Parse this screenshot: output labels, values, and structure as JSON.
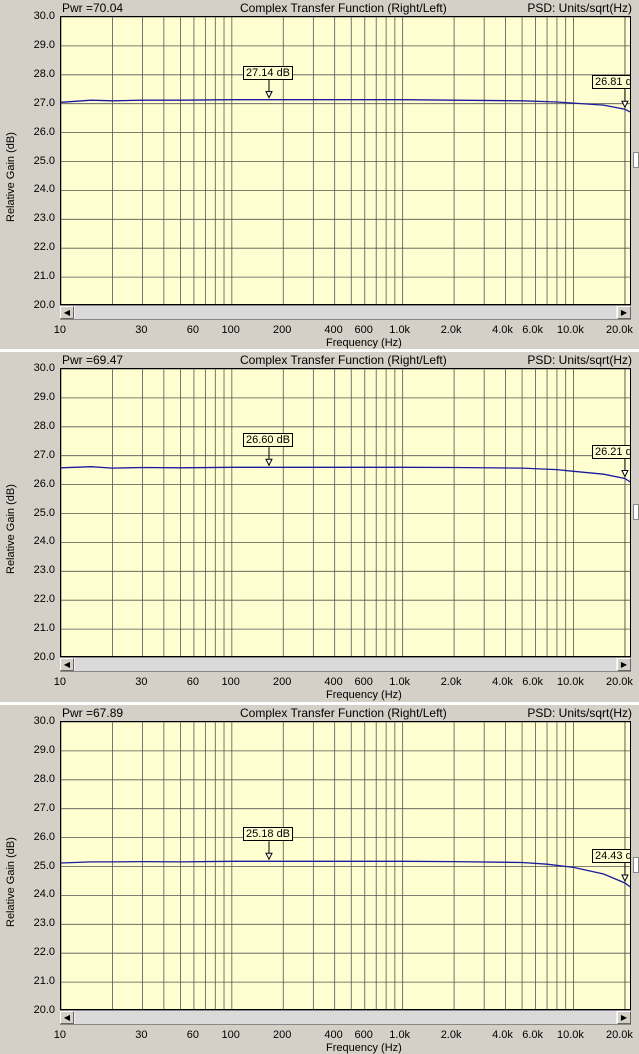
{
  "colors": {
    "plot_bg": "#fefed0",
    "grid": "#000000",
    "trace": "#1a1aa0",
    "window_bg": "#d4d0c8"
  },
  "icons": [
    "scroll-left-arrow-icon",
    "scroll-right-arrow-icon"
  ],
  "chart_data": [
    {
      "type": "line",
      "pwr_label": "Pwr =70.04",
      "title": "Complex Transfer Function (Right/Left)",
      "psd_label": "PSD: Units/sqrt(Hz)",
      "xlabel": "Frequency (Hz)",
      "ylabel": "Relative Gain (dB)",
      "xscale": "log",
      "xlim": [
        10,
        22000
      ],
      "ylim": [
        20.0,
        30.0
      ],
      "yticks": [
        "20.0",
        "21.0",
        "22.0",
        "23.0",
        "24.0",
        "25.0",
        "26.0",
        "27.0",
        "28.0",
        "29.0",
        "30.0"
      ],
      "xticks": [
        "10",
        "30",
        "60",
        "100",
        "200",
        "400",
        "600",
        "1.0k",
        "2.0k",
        "4.0k",
        "6.0k",
        "10.0k",
        "20.0k"
      ],
      "grid": true,
      "series": [
        {
          "x": [
            10,
            15,
            20,
            30,
            50,
            100,
            200,
            500,
            1000,
            2000,
            5000,
            8000,
            10000,
            15000,
            20000,
            22000
          ],
          "y": [
            27.05,
            27.12,
            27.1,
            27.12,
            27.12,
            27.14,
            27.14,
            27.14,
            27.14,
            27.12,
            27.1,
            27.06,
            27.02,
            26.95,
            26.81,
            26.68
          ]
        }
      ],
      "markers": [
        {
          "x": 165,
          "label": "27.14 dB"
        },
        {
          "x": 20000,
          "label": "26.81 d"
        }
      ]
    },
    {
      "type": "line",
      "pwr_label": "Pwr =69.47",
      "title": "Complex Transfer Function (Right/Left)",
      "psd_label": "PSD: Units/sqrt(Hz)",
      "xlabel": "Frequency (Hz)",
      "ylabel": "Relative Gain (dB)",
      "xscale": "log",
      "xlim": [
        10,
        22000
      ],
      "ylim": [
        20.0,
        30.0
      ],
      "yticks": [
        "20.0",
        "21.0",
        "22.0",
        "23.0",
        "24.0",
        "25.0",
        "26.0",
        "27.0",
        "28.0",
        "29.0",
        "30.0"
      ],
      "xticks": [
        "10",
        "30",
        "60",
        "100",
        "200",
        "400",
        "600",
        "1.0k",
        "2.0k",
        "4.0k",
        "6.0k",
        "10.0k",
        "20.0k"
      ],
      "grid": true,
      "series": [
        {
          "x": [
            10,
            15,
            20,
            30,
            50,
            100,
            200,
            500,
            1000,
            2000,
            5000,
            8000,
            10000,
            15000,
            20000,
            22000
          ],
          "y": [
            26.58,
            26.62,
            26.57,
            26.59,
            26.58,
            26.6,
            26.6,
            26.6,
            26.6,
            26.59,
            26.57,
            26.52,
            26.46,
            26.36,
            26.21,
            26.05
          ]
        }
      ],
      "markers": [
        {
          "x": 165,
          "label": "26.60 dB"
        },
        {
          "x": 20000,
          "label": "26.21 d"
        }
      ]
    },
    {
      "type": "line",
      "pwr_label": "Pwr =67.89",
      "title": "Complex Transfer Function (Right/Left)",
      "psd_label": "PSD: Units/sqrt(Hz)",
      "xlabel": "Frequency (Hz)",
      "ylabel": "Relative Gain (dB)",
      "xscale": "log",
      "xlim": [
        10,
        22000
      ],
      "ylim": [
        20.0,
        30.0
      ],
      "yticks": [
        "20.0",
        "21.0",
        "22.0",
        "23.0",
        "24.0",
        "25.0",
        "26.0",
        "27.0",
        "28.0",
        "29.0",
        "30.0"
      ],
      "xticks": [
        "10",
        "30",
        "60",
        "100",
        "200",
        "400",
        "600",
        "1.0k",
        "2.0k",
        "4.0k",
        "6.0k",
        "10.0k",
        "20.0k"
      ],
      "grid": true,
      "series": [
        {
          "x": [
            10,
            15,
            20,
            30,
            50,
            100,
            200,
            500,
            1000,
            2000,
            5000,
            7000,
            10000,
            15000,
            20000,
            22000
          ],
          "y": [
            25.12,
            25.16,
            25.16,
            25.17,
            25.16,
            25.18,
            25.18,
            25.18,
            25.18,
            25.17,
            25.14,
            25.08,
            24.97,
            24.74,
            24.43,
            24.25
          ]
        }
      ],
      "markers": [
        {
          "x": 165,
          "label": "25.18 dB"
        },
        {
          "x": 20000,
          "label": "24.43 d"
        }
      ]
    }
  ]
}
